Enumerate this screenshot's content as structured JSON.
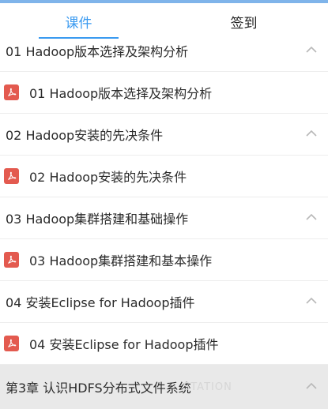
{
  "tabs": {
    "courseware_label": "课件",
    "signin_label": "签到"
  },
  "colors": {
    "accent": "#3a9af0",
    "pdf_red": "#e35a4f",
    "chapter_bg": "#e9e9e9"
  },
  "sections": [
    {
      "title": "01 Hadoop版本选择及架构分析",
      "expanded": true,
      "icon": "chevron-up-icon"
    },
    {
      "title": "02 Hadoop安装的先决条件",
      "expanded": true,
      "icon": "chevron-up-icon"
    },
    {
      "title": "03 Hadoop集群搭建和基础操作",
      "expanded": true,
      "icon": "chevron-up-icon"
    },
    {
      "title": "04 安装Eclipse for Hadoop插件",
      "expanded": true,
      "icon": "chevron-up-icon"
    }
  ],
  "items": [
    {
      "title": "01 Hadoop版本选择及架构分析",
      "icon": "pdf-icon"
    },
    {
      "title": "02 Hadoop安装的先决条件",
      "icon": "pdf-icon"
    },
    {
      "title": "03 Hadoop集群搭建和基本操作",
      "icon": "pdf-icon"
    },
    {
      "title": "04 安装Eclipse for Hadoop插件",
      "icon": "pdf-icon"
    }
  ],
  "chapter": {
    "title": "第3章 认识HDFS分布式文件系统",
    "watermark": "STATION",
    "icon": "chevron-up-icon"
  }
}
